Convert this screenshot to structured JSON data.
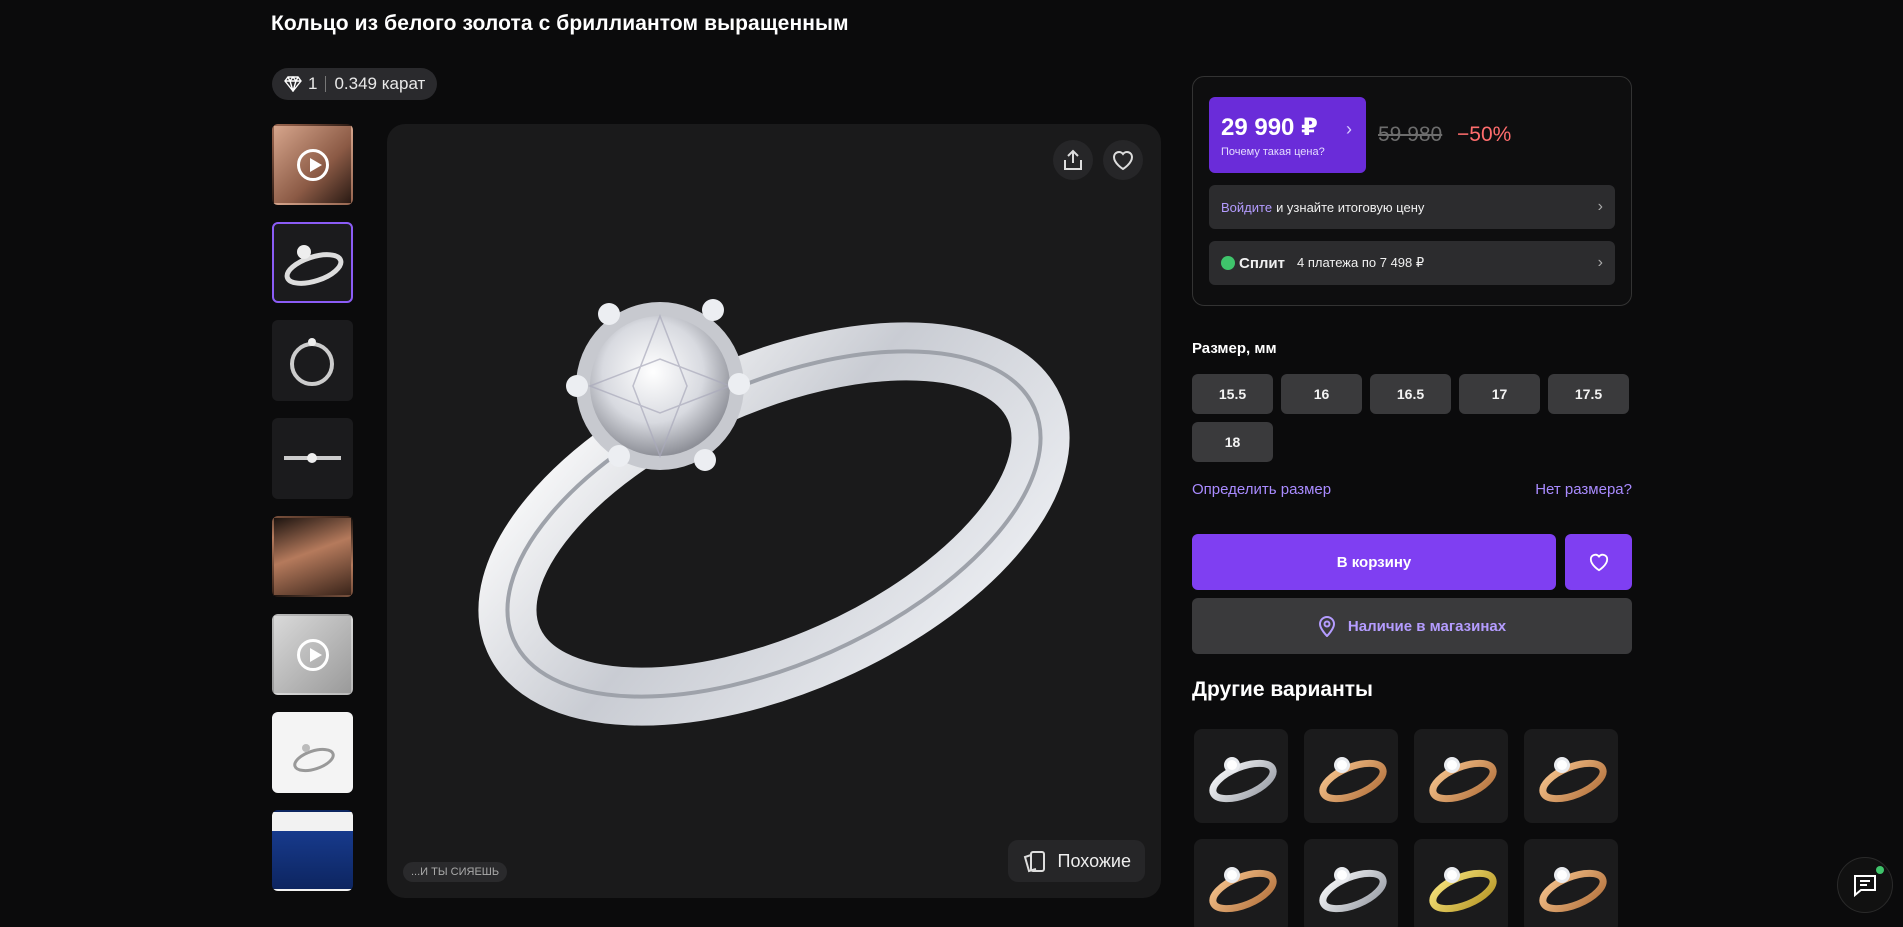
{
  "product": {
    "title": "Кольцо из белого золота с бриллиантом выращенным",
    "stones_count": "1",
    "carat": "0.349 карат"
  },
  "gallery": {
    "thumbnails": [
      {
        "name": "hand-video-thumb",
        "video": true
      },
      {
        "name": "ring-side-thumb",
        "video": false,
        "active": true
      },
      {
        "name": "ring-front-thumb",
        "video": false
      },
      {
        "name": "ring-top-thumb",
        "video": false
      },
      {
        "name": "hand-photo-thumb",
        "video": false
      },
      {
        "name": "ring-video-thumb",
        "video": true
      },
      {
        "name": "ring-certificate-thumb",
        "video": false
      },
      {
        "name": "care-kit-thumb",
        "video": false
      }
    ],
    "slogan": "...И ТЫ СИЯЕШЬ",
    "similar_label": "Похожие"
  },
  "pricing": {
    "price": "29 990 ₽",
    "why_label": "Почему такая цена?",
    "old_price": "59 980",
    "discount": "−50%",
    "login_link": "Войдите",
    "login_text": "и узнайте итоговую цену",
    "split_brand": "Сплит",
    "split_text": "4 платежа по 7 498 ₽"
  },
  "sizes": {
    "label": "Размер, мм",
    "options": [
      "15.5",
      "16",
      "16.5",
      "17",
      "17.5",
      "18"
    ],
    "determine_link": "Определить размер",
    "no_size_link": "Нет размера?"
  },
  "actions": {
    "cart_label": "В корзину",
    "stores_label": "Наличие в магазинах"
  },
  "variants": {
    "title": "Другие варианты",
    "items": [
      "white",
      "rose",
      "rose",
      "rose",
      "rose",
      "white",
      "yellow",
      "rose"
    ]
  },
  "colors": {
    "accent": "#7f3ff2",
    "price_bg": "#6a2cd9",
    "discount": "#ff6d6d",
    "link": "#a98bff"
  }
}
